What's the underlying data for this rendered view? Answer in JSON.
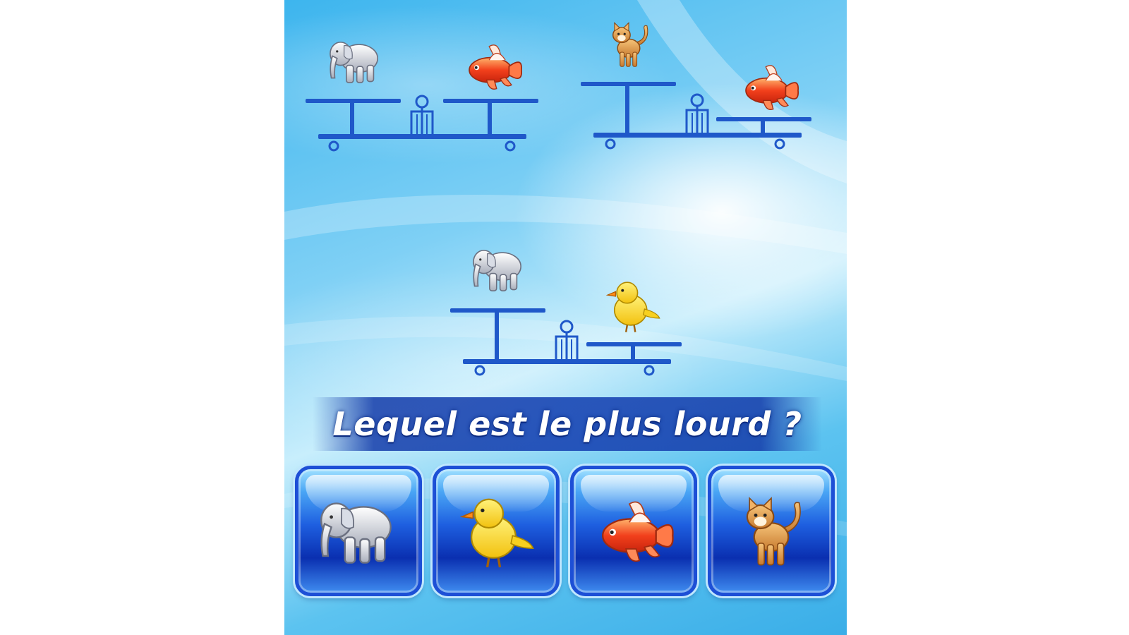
{
  "question": "Lequel est le plus lourd ?",
  "colors": {
    "scale_blue": "#1f58c9",
    "button_blue": "#1e5fe0",
    "banner_blue": "#1946b4"
  },
  "scales": [
    {
      "left_animal": "elephant",
      "right_animal": "goldfish",
      "heavier_side": "balanced"
    },
    {
      "left_animal": "cat",
      "right_animal": "goldfish",
      "heavier_side": "right"
    },
    {
      "left_animal": "elephant",
      "right_animal": "chick",
      "heavier_side": "right"
    }
  ],
  "choices": [
    {
      "animal": "elephant",
      "icon": "elephant-icon"
    },
    {
      "animal": "chick",
      "icon": "chick-icon"
    },
    {
      "animal": "goldfish",
      "icon": "goldfish-icon"
    },
    {
      "animal": "cat",
      "icon": "cat-icon"
    }
  ]
}
